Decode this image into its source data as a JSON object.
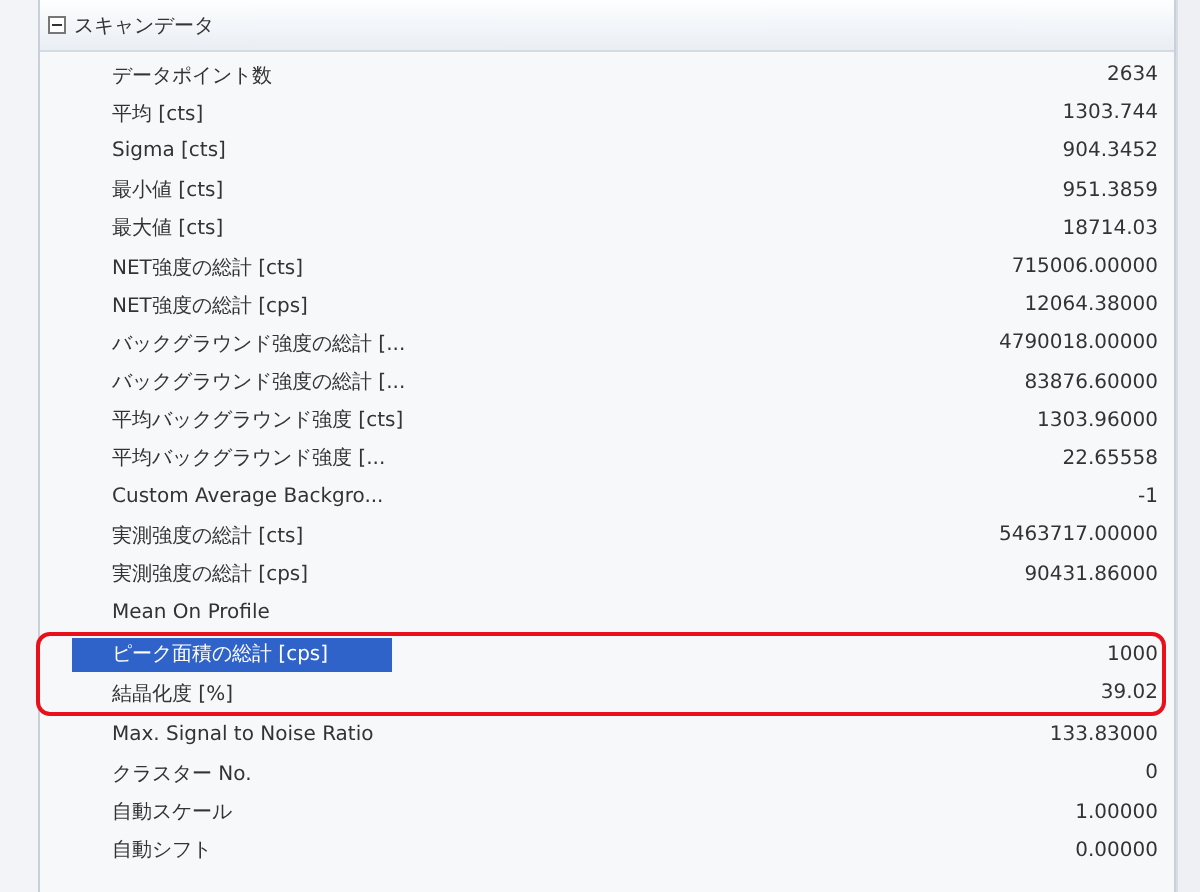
{
  "group": {
    "title": "スキャンデータ",
    "expanded": true
  },
  "rows": [
    {
      "kind": "row",
      "label": "データポイント数",
      "value": "2634",
      "selected": false
    },
    {
      "kind": "row",
      "label": "平均 [cts]",
      "value": "1303.744",
      "selected": false
    },
    {
      "kind": "row",
      "label": "Sigma [cts]",
      "value": "904.3452",
      "selected": false
    },
    {
      "kind": "row",
      "label": "最小値 [cts]",
      "value": "951.3859",
      "selected": false
    },
    {
      "kind": "row",
      "label": "最大値 [cts]",
      "value": "18714.03",
      "selected": false
    },
    {
      "kind": "row",
      "label": "NET強度の総計 [cts]",
      "value": "715006.00000",
      "selected": false
    },
    {
      "kind": "row",
      "label": "NET強度の総計 [cps]",
      "value": "12064.38000",
      "selected": false
    },
    {
      "kind": "row",
      "label": "バックグラウンド強度の総計 [...",
      "value": "4790018.00000",
      "selected": false
    },
    {
      "kind": "row",
      "label": "バックグラウンド強度の総計 [...",
      "value": "83876.60000",
      "selected": false
    },
    {
      "kind": "row",
      "label": "平均バックグラウンド強度 [cts]",
      "value": "1303.96000",
      "selected": false
    },
    {
      "kind": "row",
      "label": "平均バックグラウンド強度 [...",
      "value": "22.65558",
      "selected": false
    },
    {
      "kind": "row",
      "label": "Custom Average Backgro...",
      "value": "-1",
      "selected": false
    },
    {
      "kind": "row",
      "label": "実測強度の総計 [cts]",
      "value": "5463717.00000",
      "selected": false
    },
    {
      "kind": "row",
      "label": "実測強度の総計 [cps]",
      "value": "90431.86000",
      "selected": false
    },
    {
      "kind": "row",
      "label": "Mean On Profile",
      "selected": false
    },
    {
      "kind": "highlight_group",
      "rows": [
        {
          "label": "ピーク面積の総計 [cps]",
          "value": "1000",
          "selected": true
        },
        {
          "label": "結晶化度 [%]",
          "value": "39.02",
          "selected": false
        }
      ]
    },
    {
      "kind": "row",
      "label": "Max. Signal to Noise Ratio",
      "value": "133.83000",
      "selected": false
    },
    {
      "kind": "row",
      "label": "クラスター No.",
      "value": "0",
      "selected": false
    },
    {
      "kind": "row",
      "label": "自動スケール",
      "value": "1.00000",
      "selected": false
    },
    {
      "kind": "row",
      "label": "自動シフト",
      "value": "0.00000",
      "selected": false
    }
  ]
}
